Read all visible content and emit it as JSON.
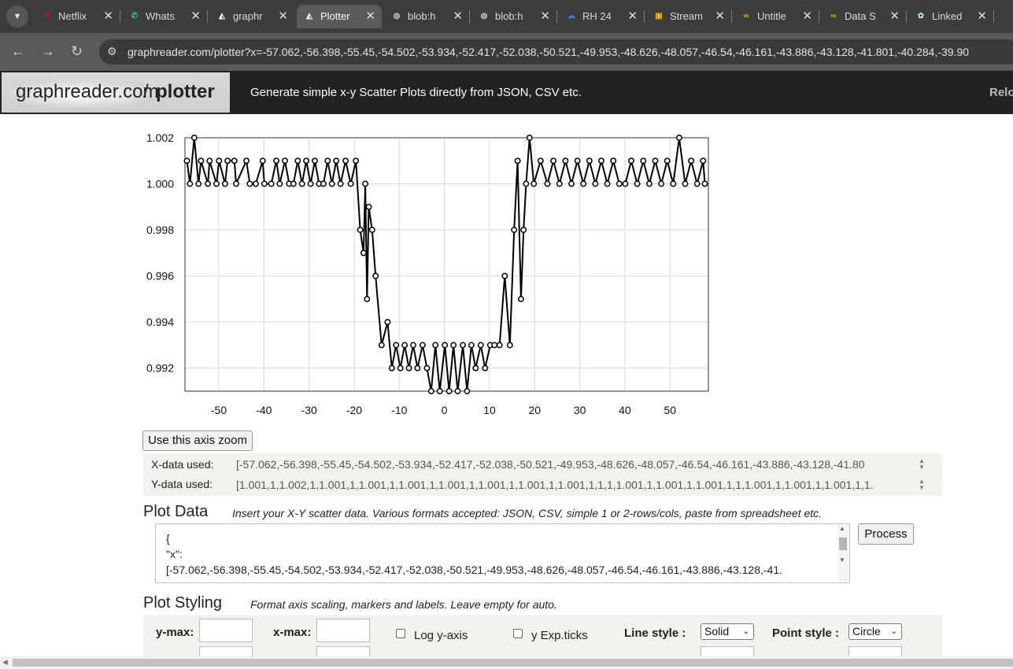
{
  "browser": {
    "tabs": [
      {
        "title": "Netflix",
        "icon": "netflix-icon",
        "fav_color": "#e50914",
        "fav_char": "N"
      },
      {
        "title": "Whats",
        "icon": "whatsapp-icon",
        "fav_color": "#25d366",
        "fav_char": "✆"
      },
      {
        "title": "graphr",
        "icon": "graphreader-icon",
        "fav_color": "#ffffff",
        "fav_char": "◭"
      },
      {
        "title": "Plotter",
        "icon": "graphreader-icon",
        "fav_color": "#ffffff",
        "fav_char": "◭"
      },
      {
        "title": "blob:h",
        "icon": "globe-icon",
        "fav_color": "#bdbdbd",
        "fav_char": "◍"
      },
      {
        "title": "blob:h",
        "icon": "globe-icon",
        "fav_color": "#bdbdbd",
        "fav_char": "◍"
      },
      {
        "title": "RH 24",
        "icon": "onedrive-icon",
        "fav_color": "#1e88e5",
        "fav_char": "☁"
      },
      {
        "title": "Stream",
        "icon": "google-slides-icon",
        "fav_color": "#f4b400",
        "fav_char": "▣"
      },
      {
        "title": "Untitle",
        "icon": "colab-icon",
        "fav_color": "#f9ab00",
        "fav_char": "∞"
      },
      {
        "title": "Data S",
        "icon": "colab-icon",
        "fav_color": "#f9ab00",
        "fav_char": "∞"
      },
      {
        "title": "Linked",
        "icon": "chatgpt-icon",
        "fav_color": "#bfe3d6",
        "fav_char": "✿"
      }
    ],
    "active_tab": 3,
    "url": "graphreader.com/plotter?x=-57.062,-56.398,-55.45,-54.502,-53.934,-52.417,-52.038,-50.521,-49.953,-48.626,-48.057,-46.54,-46.161,-43.886,-43.128,-41.801,-40.284,-39.90"
  },
  "header": {
    "logo_domain": "graphreader.com",
    "logo_slash": "/",
    "logo_path": "plotter",
    "tagline": "Generate simple x-y Scatter Plots directly from JSON, CSV etc.",
    "right_text": "Relo"
  },
  "chart_data": {
    "type": "line",
    "marker": "circle",
    "xlim": [
      -57.5,
      58.5
    ],
    "ylim": [
      0.991,
      1.002
    ],
    "x_ticks": [
      -50,
      -40,
      -30,
      -20,
      -10,
      0,
      10,
      20,
      30,
      40,
      50
    ],
    "y_ticks": [
      0.992,
      0.994,
      0.996,
      0.998,
      1.0,
      1.002
    ],
    "grid": true,
    "series": [
      {
        "x": [
          -57.062,
          -56.398,
          -55.45,
          -54.502,
          -53.934,
          -52.417,
          -52.038,
          -50.521,
          -49.953,
          -48.626,
          -48.057,
          -46.54,
          -46.161,
          -43.886,
          -43.128,
          -41.801,
          -40.284,
          -39.905,
          -38.388,
          -37.251,
          -36.492,
          -35.355,
          -34.407,
          -33.459,
          -32.511,
          -31.563,
          -30.615,
          -29.667,
          -28.719,
          -27.771,
          -26.823,
          -25.875,
          -24.927,
          -23.979,
          -23.031,
          -21.894,
          -20.757,
          -19.62,
          -18.672,
          -17.913,
          -17.534,
          -17.155,
          -16.776,
          -16.018,
          -15.259,
          -13.932,
          -12.605,
          -11.657,
          -10.709,
          -9.761,
          -8.813,
          -7.865,
          -6.917,
          -5.969,
          -4.832,
          -3.884,
          -2.936,
          -1.988,
          -1.04,
          0.097,
          1.045,
          1.993,
          2.941,
          4.078,
          5.026,
          5.974,
          6.922,
          8.059,
          9.007,
          10.144,
          11.092,
          12.229,
          13.366,
          14.503,
          15.451,
          16.21,
          16.968,
          17.537,
          18.106,
          18.864,
          19.812,
          21.318,
          22.834,
          24.161,
          25.488,
          26.815,
          28.142,
          29.469,
          30.796,
          32.123,
          33.45,
          34.777,
          36.104,
          37.431,
          38.758,
          40.085,
          41.412,
          42.739,
          44.066,
          45.393,
          46.72,
          48.047,
          49.374,
          50.701,
          52.028,
          53.355,
          54.682,
          56.009,
          57.336,
          57.715
        ],
        "y": [
          1.001,
          1.0,
          1.002,
          1.0,
          1.001,
          1.0,
          1.001,
          1.0,
          1.001,
          1.0,
          1.001,
          1.001,
          1.0,
          1.001,
          1.0,
          1.0,
          1.001,
          1.0,
          1.0,
          1.001,
          1.0,
          1.001,
          1.0,
          1.0,
          1.001,
          1.0,
          1.001,
          1.0,
          1.001,
          1.0,
          1.0,
          1.001,
          1.0,
          1.001,
          1.0,
          1.001,
          1.0,
          1.001,
          0.998,
          0.997,
          1.0,
          0.995,
          0.999,
          0.998,
          0.996,
          0.993,
          0.994,
          0.992,
          0.993,
          0.992,
          0.993,
          0.992,
          0.993,
          0.992,
          0.993,
          0.992,
          0.991,
          0.993,
          0.991,
          0.993,
          0.991,
          0.993,
          0.991,
          0.993,
          0.991,
          0.993,
          0.992,
          0.993,
          0.992,
          0.993,
          0.993,
          0.993,
          0.996,
          0.993,
          0.998,
          1.001,
          0.995,
          0.998,
          1.0,
          1.002,
          1.0,
          1.001,
          1.0,
          1.001,
          1.0,
          1.001,
          1.0,
          1.001,
          1.0,
          1.001,
          1.0,
          1.001,
          1.0,
          1.001,
          1.0,
          1.0,
          1.001,
          1.0,
          1.001,
          1.0,
          1.001,
          1.0,
          1.001,
          1.0,
          1.002,
          1.0,
          1.001,
          1.0,
          1.001,
          1.0
        ]
      }
    ]
  },
  "axis_zoom_button": "Use this axis zoom",
  "data_used": {
    "x_label": "X-data used:",
    "x_value": "[-57.062,-56.398,-55.45,-54.502,-53.934,-52.417,-52.038,-50.521,-49.953,-48.626,-48.057,-46.54,-46.161,-43.886,-43.128,-41.80",
    "y_label": "Y-data used:",
    "y_value": "[1.001,1,1.002,1,1.001,1,1.001,1,1.001,1,1.001,1,1.001,1,1.001,1,1.001,1,1,1,1.001,1,1.001,1,1.001,1,1,1.001,1,1.001,1,1.001,1,1."
  },
  "plot_data": {
    "title": "Plot Data",
    "subtitle": "Insert your X-Y scatter data. Various formats accepted: JSON, CSV, simple 1 or 2-rows/cols, paste from spreadsheet etc.",
    "textarea_lines": [
      "{",
      "\"x\":",
      "[-57.062,-56.398,-55.45,-54.502,-53.934,-52.417,-52.038,-50.521,-49.953,-48.626,-48.057,-46.54,-46.161,-43.886,-43.128,-41."
    ],
    "process_button": "Process"
  },
  "plot_styling": {
    "title": "Plot Styling",
    "subtitle": "Format axis scaling, markers and labels. Leave empty for auto.",
    "ymax_label": "y-max:",
    "xmax_label": "x-max:",
    "log_y_label": "Log y-axis",
    "y_exp_ticks_label": "y Exp.ticks",
    "line_style_label": "Line style :",
    "line_style_value": "Solid",
    "point_style_label": "Point style :",
    "point_style_value": "Circle"
  }
}
